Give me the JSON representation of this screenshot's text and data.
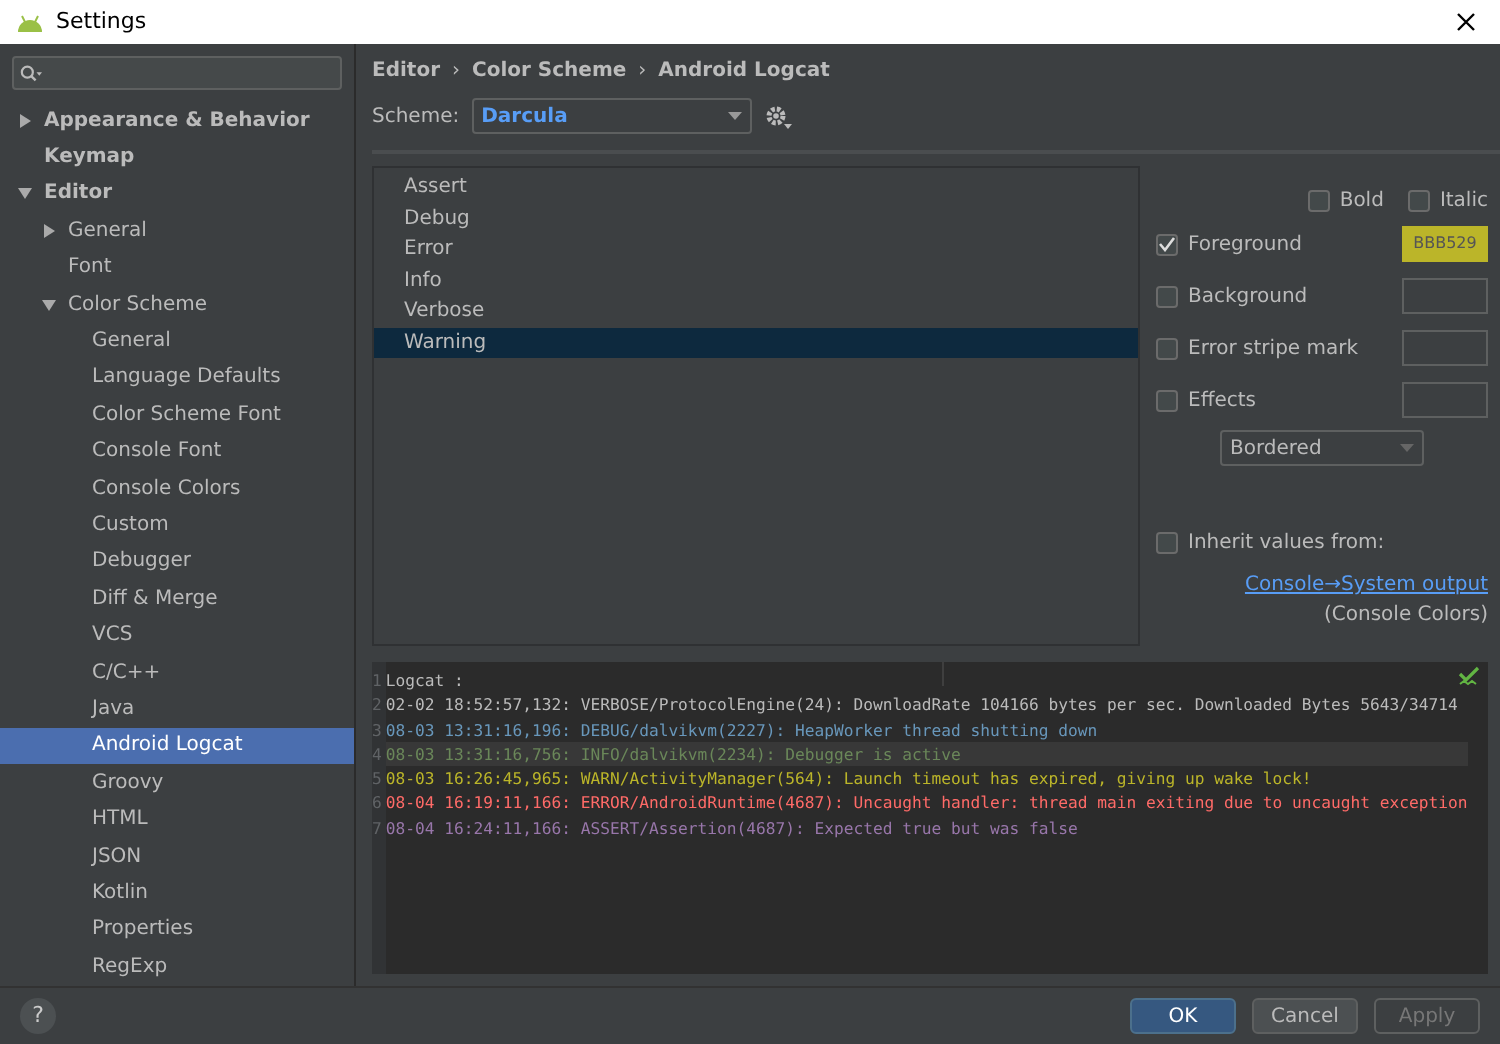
{
  "window": {
    "title": "Settings"
  },
  "sidebar": {
    "items": [
      {
        "label": "Appearance & Behavior",
        "expanded": false,
        "selected": false
      },
      {
        "label": "Keymap",
        "selected": false
      },
      {
        "label": "Editor",
        "expanded": true,
        "selected": false,
        "children": [
          {
            "label": "General",
            "expanded": false,
            "selected": false
          },
          {
            "label": "Font",
            "selected": false
          },
          {
            "label": "Color Scheme",
            "expanded": true,
            "selected": false,
            "children": [
              {
                "label": "General",
                "selected": false
              },
              {
                "label": "Language Defaults",
                "selected": false
              },
              {
                "label": "Color Scheme Font",
                "selected": false
              },
              {
                "label": "Console Font",
                "selected": false
              },
              {
                "label": "Console Colors",
                "selected": false
              },
              {
                "label": "Custom",
                "selected": false
              },
              {
                "label": "Debugger",
                "selected": false
              },
              {
                "label": "Diff & Merge",
                "selected": false
              },
              {
                "label": "VCS",
                "selected": false
              },
              {
                "label": "C/C++",
                "selected": false
              },
              {
                "label": "Java",
                "selected": false
              },
              {
                "label": "Android Logcat",
                "selected": true
              },
              {
                "label": "Groovy",
                "selected": false
              },
              {
                "label": "HTML",
                "selected": false
              },
              {
                "label": "JSON",
                "selected": false
              },
              {
                "label": "Kotlin",
                "selected": false
              },
              {
                "label": "Properties",
                "selected": false
              },
              {
                "label": "RegExp",
                "selected": false
              }
            ]
          }
        ]
      }
    ]
  },
  "breadcrumb": [
    "Editor",
    "Color Scheme",
    "Android Logcat"
  ],
  "breadcrumb_separator": "›",
  "scheme": {
    "label": "Scheme:",
    "value": "Darcula"
  },
  "levels": [
    {
      "label": "Assert",
      "selected": false
    },
    {
      "label": "Debug",
      "selected": false
    },
    {
      "label": "Error",
      "selected": false
    },
    {
      "label": "Info",
      "selected": false
    },
    {
      "label": "Verbose",
      "selected": false
    },
    {
      "label": "Warning",
      "selected": true
    }
  ],
  "font_style": [
    {
      "label": "Bold",
      "checked": false
    },
    {
      "label": "Italic",
      "checked": false
    }
  ],
  "attributes": [
    {
      "label": "Foreground",
      "checked": true,
      "value": "BBB529",
      "color": "#bbb529"
    },
    {
      "label": "Background",
      "checked": false
    },
    {
      "label": "Error stripe mark",
      "checked": false
    },
    {
      "label": "Effects",
      "checked": false
    }
  ],
  "effect_type": {
    "value": "Bordered"
  },
  "inherit": {
    "label": "Inherit values from:",
    "checked": false,
    "link": "Console→System output",
    "note": "(Console Colors)"
  },
  "preview": {
    "lines": [
      {
        "number": "1",
        "text": "Logcat :",
        "color": "#bbbbbb",
        "current": false
      },
      {
        "number": "2",
        "text": "02-02 18:52:57,132: VERBOSE/ProtocolEngine(24): DownloadRate 104166 bytes per sec. Downloaded Bytes 5643/34714",
        "color": "#bbbbbb",
        "current": false
      },
      {
        "number": "3",
        "text": "08-03 13:31:16,196: DEBUG/dalvikvm(2227): HeapWorker thread shutting down",
        "color": "#6897bb",
        "current": false
      },
      {
        "number": "4",
        "text": "08-03 13:31:16,756: INFO/dalvikvm(2234): Debugger is active",
        "color": "#6a8759",
        "current": true
      },
      {
        "number": "5",
        "text": "08-03 16:26:45,965: WARN/ActivityManager(564): Launch timeout has expired, giving up wake lock!",
        "color": "#bbb529",
        "current": false
      },
      {
        "number": "6",
        "text": "08-04 16:19:11,166: ERROR/AndroidRuntime(4687): Uncaught handler: thread main exiting due to uncaught exception",
        "color": "#ff6b68",
        "current": false
      },
      {
        "number": "7",
        "text": "08-04 16:24:11,166: ASSERT/Assertion(4687): Expected true but was false",
        "color": "#9876aa",
        "current": false
      }
    ]
  },
  "help": "?",
  "buttons": [
    {
      "label": "OK",
      "kind": "default",
      "disabled": false
    },
    {
      "label": "Cancel",
      "kind": "normal",
      "disabled": false
    },
    {
      "label": "Apply",
      "kind": "normal",
      "disabled": true
    }
  ]
}
